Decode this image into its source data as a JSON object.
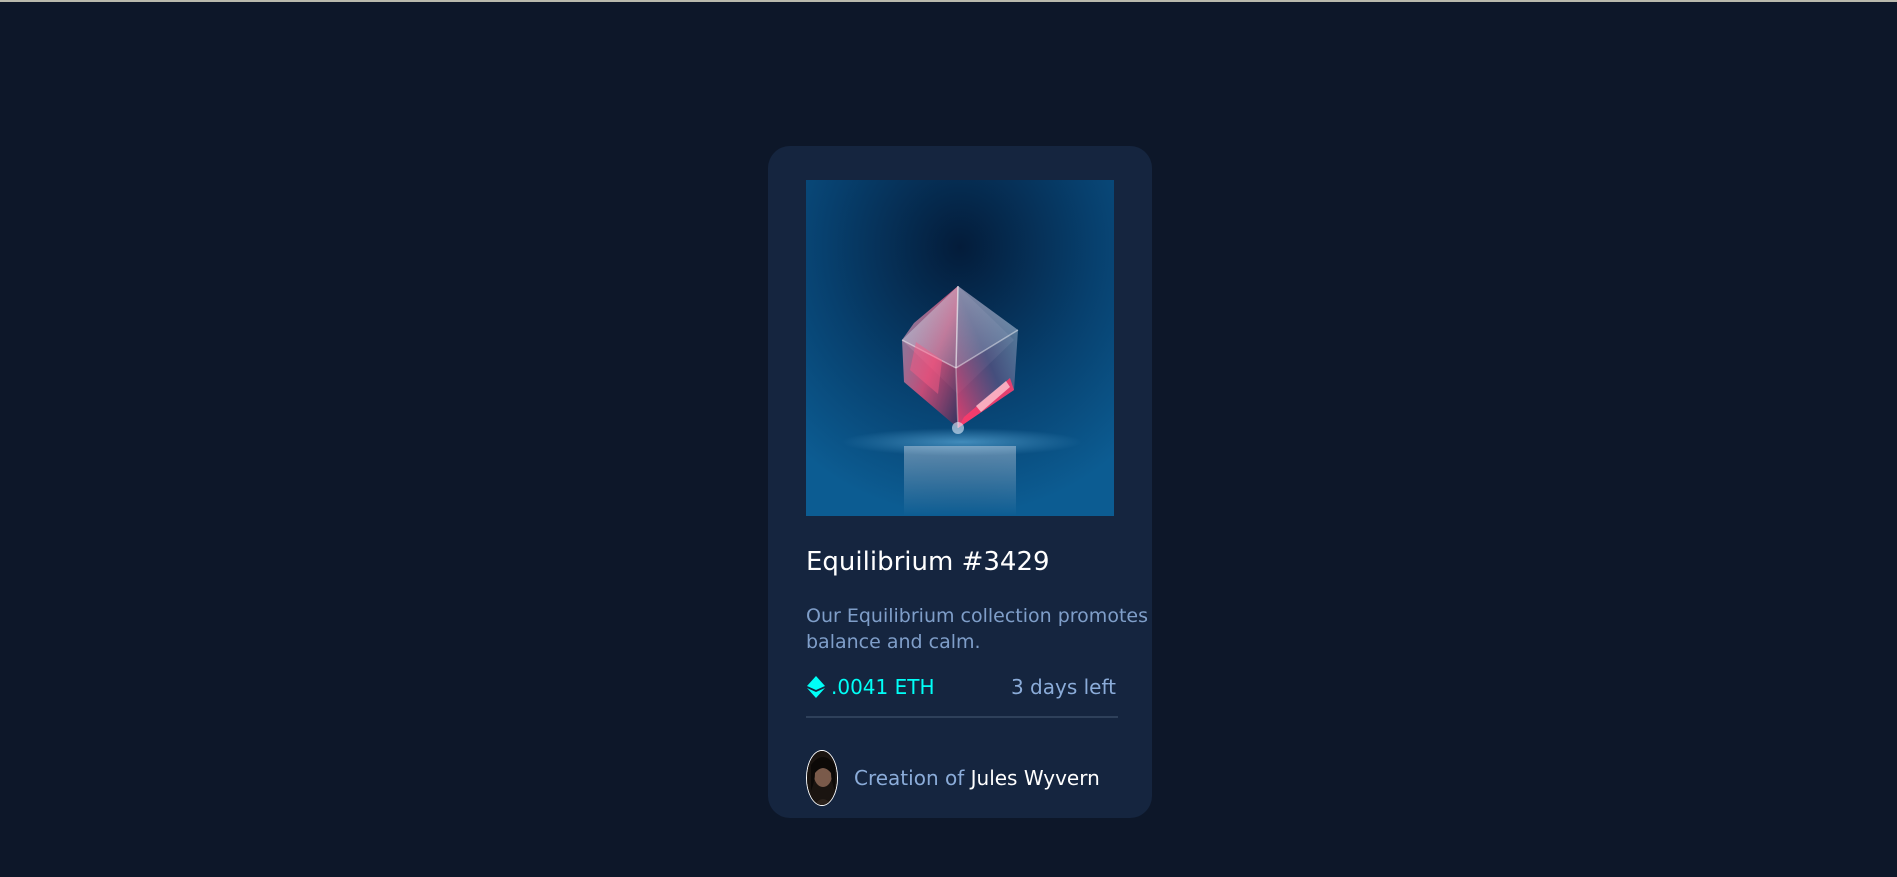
{
  "card": {
    "image_alt": "Equilibrium",
    "title": "Equilibrium #3429",
    "description": "Our Equilibrium collection promotes balance and calm.",
    "price": ".0041 ETH",
    "time_left": "3 days left",
    "creator_prefix": "Creation of",
    "creator_name": "Jules Wyvern"
  },
  "icons": {
    "price": "ethereum-icon",
    "avatar": "avatar-image"
  },
  "colors": {
    "page_background": "#0d1729",
    "card_background": "#15253f",
    "accent_cyan": "#00fff7",
    "soft_blue": "#8bacd9",
    "white": "#ffffff",
    "divider": "#2e405a"
  }
}
